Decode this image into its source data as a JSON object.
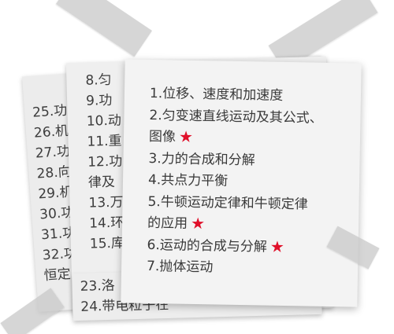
{
  "back_note": {
    "items": [
      "25.功",
      "26.机",
      "27.功",
      "28.向",
      "29.机",
      "30.功",
      "31.功",
      "32.功",
      "恒定"
    ]
  },
  "mid_note": {
    "items": [
      "8.匀",
      "9.功",
      "10.动",
      "11.重",
      "12.功",
      "律及",
      "13.万",
      "14.环",
      "15.库"
    ]
  },
  "strip_note": {
    "items": [
      "23.洛",
      "24.带电粒子在"
    ]
  },
  "front_note": {
    "items": [
      {
        "text": "1.位移、速度和加速度",
        "star": false
      },
      {
        "text": "2.匀变速直线运动及其公式、",
        "star": false
      },
      {
        "text": "图像",
        "star": true
      },
      {
        "text": "3.力的合成和分解",
        "star": false
      },
      {
        "text": "4.共点力平衡",
        "star": false
      },
      {
        "text": "5.牛顿运动定律和牛顿定律",
        "star": false
      },
      {
        "text": "的应用",
        "star": true
      },
      {
        "text": "6.运动的合成与分解",
        "star": true
      },
      {
        "text": "7.抛体运动",
        "star": false
      }
    ],
    "star_symbol": "★",
    "star_color": "#e0102a"
  }
}
